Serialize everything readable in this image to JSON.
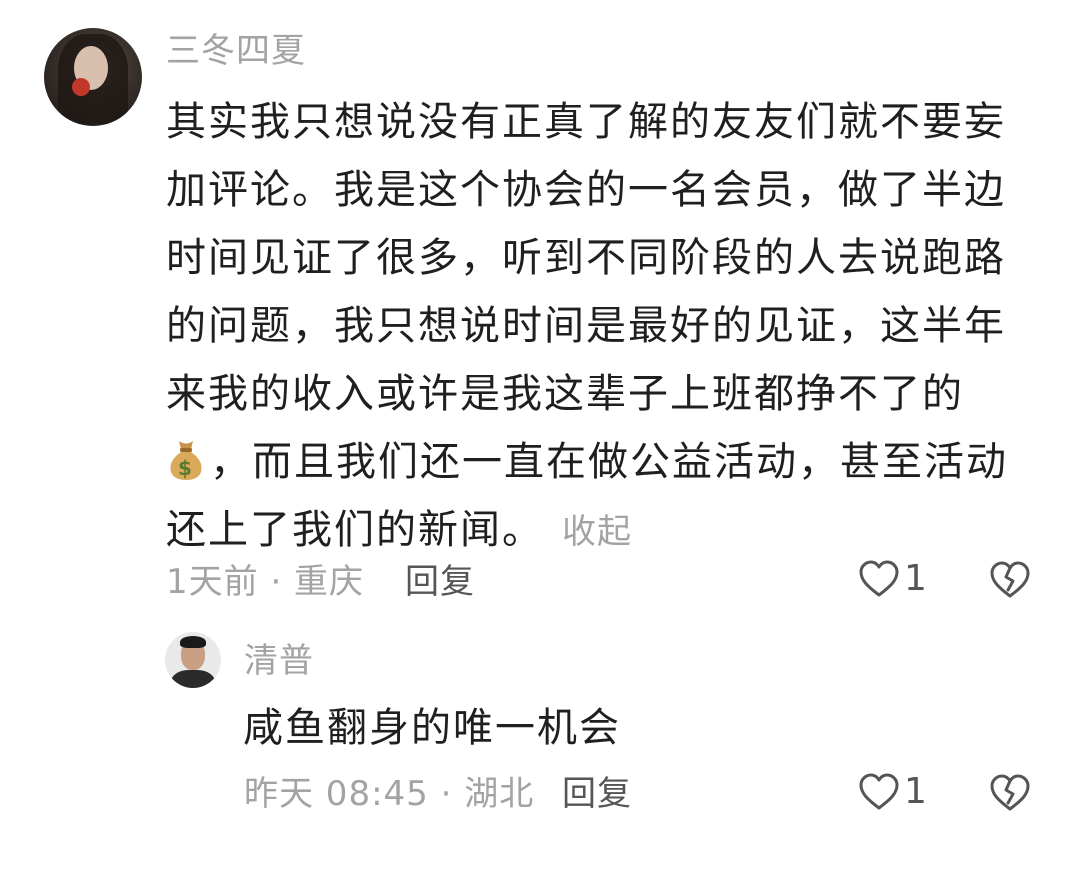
{
  "comment": {
    "author": "三冬四夏",
    "lines": [
      "其实我只想说没有正真了解的友友们就不要妄",
      "加评论。我是这个协会的一名会员，做了半边",
      "时间见证了很多，听到不同阶段的人去说跑路",
      "的问题，我只想说时间是最好的见证，这半年",
      "来我的收入或许是我这辈子上班都挣不了的",
      "，而且我们还一直在做公益活动，甚至活动",
      "还上了我们的新闻。"
    ],
    "emoji": "money-bag-icon",
    "collapse_label": "收起",
    "meta": "1天前 · 重庆",
    "reply_label": "回复",
    "like_count": "1"
  },
  "reply": {
    "author": "清普",
    "text": "咸鱼翻身的唯一机会",
    "meta": "昨天 08:45 · 湖北",
    "reply_label": "回复",
    "like_count": "1"
  },
  "colors": {
    "text": "#1f1f1f",
    "muted": "#a3a3a3",
    "action": "#555555",
    "background": "#ffffff"
  }
}
